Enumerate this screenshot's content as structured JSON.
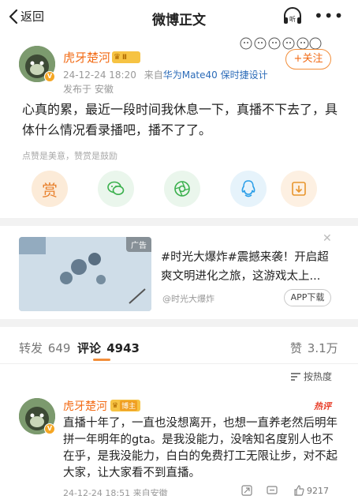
{
  "nav": {
    "back_label": "返回",
    "title": "微博正文"
  },
  "post": {
    "author": "虎牙楚河",
    "medal": "Ⅱ",
    "time": "24-12-24 18:20",
    "source_prefix": "来自",
    "source_device": "华为Mate40 保时捷设计",
    "location": "发布于 安徽",
    "follow_label": "+关注",
    "text": "心真的累，最近一段时间我休息一下，真播不下去了，具体什么情况看录播吧，播不了了。",
    "reward_hint": "点赞是美意，赞赏是鼓励",
    "reward_label": "赏"
  },
  "ad": {
    "tag": "广告",
    "text": "#时光大爆炸#震撼来袭！开启超爽文明进化之旅，这游戏太上...",
    "sponsor": "@时光大爆炸",
    "button": "APP下载"
  },
  "tabs": {
    "repost_label": "转发",
    "repost_count": "649",
    "comment_label": "评论",
    "comment_count": "4943",
    "like_label": "赞",
    "like_count": "3.1万"
  },
  "sort_label": "按热度",
  "comment": {
    "author": "虎牙楚河",
    "medal": "博主",
    "hot_tag": "热评",
    "text": "直播十年了，一直也没想离开，也想一直养老然后明年拼一年明年的gta。是我没能力，没啥知名度别人也不在乎，是我没能力，白白的免费打工无限让步，对不起大家，让大家看不到直播。",
    "meta": "24-12-24 18:51 来自安徽",
    "like_count": "9217"
  },
  "colors": {
    "accent": "#f26b16",
    "link": "#2b6bb8",
    "hot": "#e8402c"
  }
}
